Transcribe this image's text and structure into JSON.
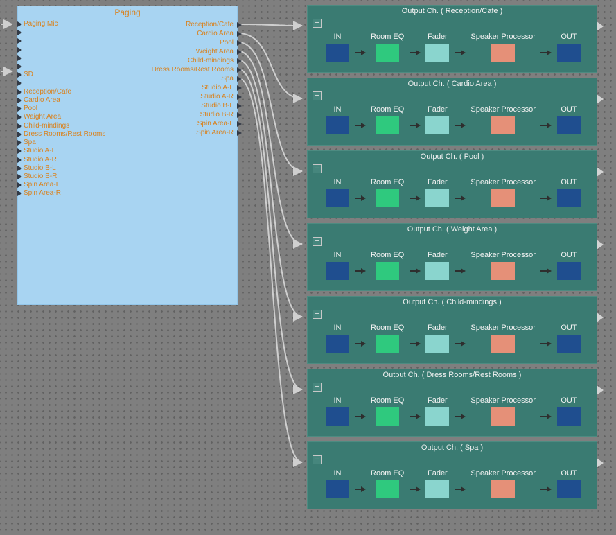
{
  "paging": {
    "title": "Paging",
    "inputs": [
      "Paging Mic",
      "SD",
      "Reception/Cafe",
      "Cardio Area",
      "Pool",
      "Waight Area",
      "Child-mindings",
      "Dress Rooms/Rest Rooms",
      "Spa",
      "Studio A-L",
      "Studio A-R",
      "Studio B-L",
      "Studio B-R",
      "Spin Area-L",
      "Spin Area-R"
    ],
    "outputs": [
      "Reception/Cafe",
      "Cardio Area",
      "Pool",
      "Weight Area",
      "Child-mindings",
      "Dress Rooms/Rest Rooms",
      "Spa",
      "Studio A-L",
      "Studio A-R",
      "Studio B-L",
      "Studio B-R",
      "Spin Area-L",
      "Spin Area-R"
    ]
  },
  "output_channels": [
    {
      "title": "Output Ch. ( Reception/Cafe )"
    },
    {
      "title": "Output Ch. ( Cardio Area )"
    },
    {
      "title": "Output Ch. ( Pool )"
    },
    {
      "title": "Output Ch. ( Weight Area )"
    },
    {
      "title": "Output Ch. ( Child-mindings )"
    },
    {
      "title": "Output Ch. ( Dress Rooms/Rest Rooms )"
    },
    {
      "title": "Output Ch. ( Spa )"
    }
  ],
  "modules": [
    "IN",
    "Room EQ",
    "Fader",
    "Speaker Processor",
    "OUT"
  ],
  "collapse_button": {
    "symbol": "−"
  },
  "colors": {
    "canvas_bg": "#7F7F7F",
    "paging_block": "#A8D4F2",
    "paging_text": "#D9821E",
    "channel_block": "#3A7B72",
    "channel_text": "#F2F2F2",
    "in_out_module": "#1F4E8F",
    "room_eq_module": "#2FC97E",
    "fader_module": "#8AD5CE",
    "speaker_processor_module": "#E59078",
    "wire": "#CFCFCF"
  }
}
